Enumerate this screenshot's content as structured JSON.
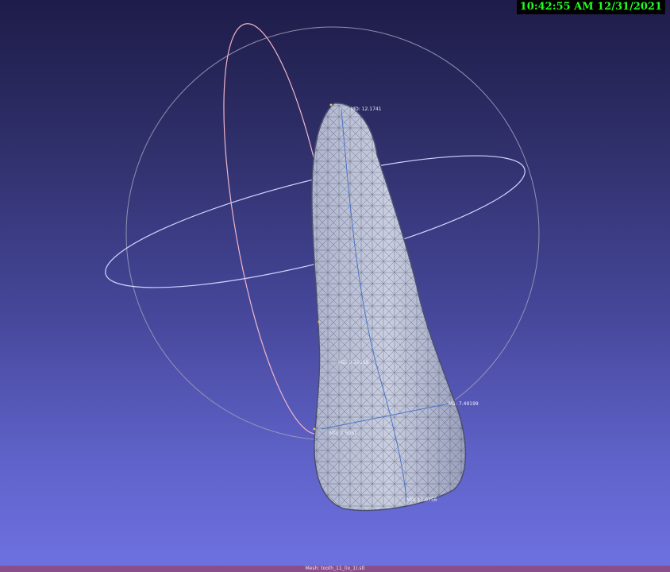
{
  "clock": "10:42:55 AM 12/31/2021",
  "status_bar": "Mesh: tooth_11_(ix_1).stl",
  "measurements": [
    "MD: 12.1741",
    "MD: 9.19168",
    "M1: 7.49199",
    "MD: 7.5031",
    "MD: 11.0756"
  ]
}
